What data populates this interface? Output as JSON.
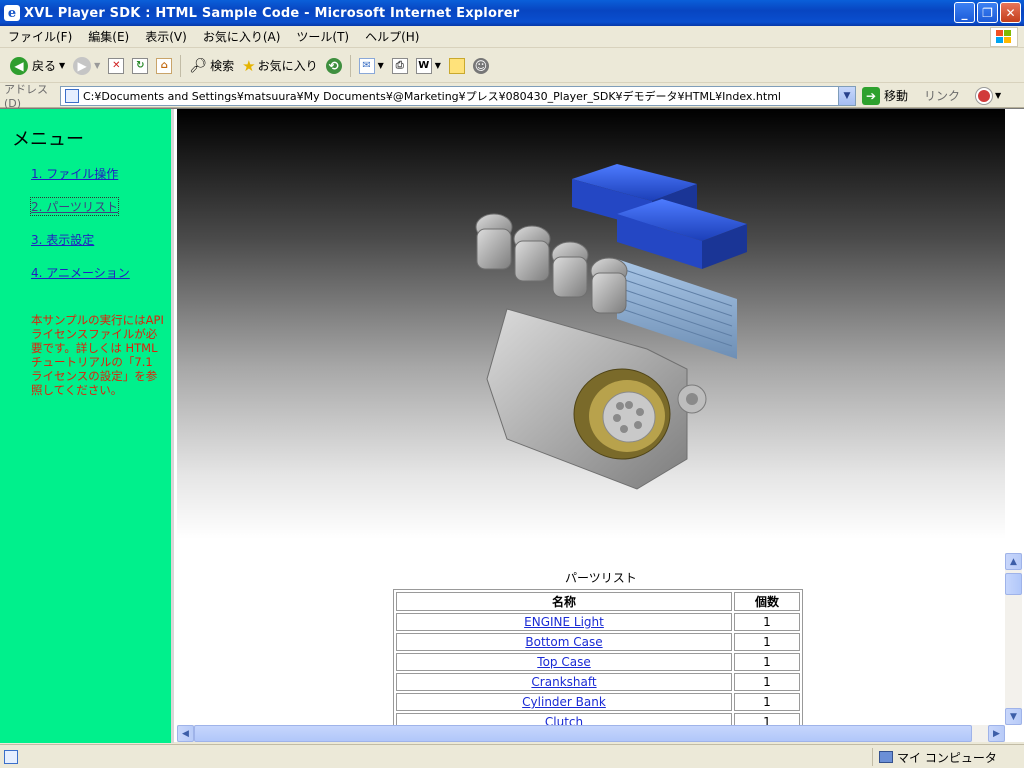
{
  "window": {
    "title": "XVL Player SDK : HTML Sample Code - Microsoft Internet Explorer",
    "minimize": "_",
    "maximize": "❐",
    "close": "✕"
  },
  "menubar": [
    "ファイル(F)",
    "編集(E)",
    "表示(V)",
    "お気に入り(A)",
    "ツール(T)",
    "ヘルプ(H)"
  ],
  "toolbar": {
    "back_label": "戻る",
    "search_label": "検索",
    "favorites_label": "お気に入り"
  },
  "addressbar": {
    "label": "アドレス(D)",
    "url": "C:¥Documents and Settings¥matsuura¥My Documents¥@Marketing¥プレス¥080430_Player_SDK¥デモデータ¥HTML¥Index.html",
    "go_label": "移動",
    "links_label": "リンク"
  },
  "menu": {
    "heading": "メニュー",
    "items": [
      "1. ファイル操作",
      "2. パーツリスト",
      "3. 表示設定",
      "4. アニメーション"
    ],
    "note": "本サンプルの実行にはAPIライセンスファイルが必要です。詳しくは HTML チュートリアルの「7.1 ライセンスの設定」を参照してください。"
  },
  "parts": {
    "caption": "パーツリスト",
    "header_name": "名称",
    "header_count": "個数",
    "rows": [
      {
        "name": "ENGINE Light",
        "count": "1"
      },
      {
        "name": "Bottom Case",
        "count": "1"
      },
      {
        "name": "Top Case",
        "count": "1"
      },
      {
        "name": "Crankshaft",
        "count": "1"
      },
      {
        "name": "Cylinder Bank",
        "count": "1"
      },
      {
        "name": "Clutch",
        "count": "1"
      }
    ]
  },
  "statusbar": {
    "zone_label": "マイ コンピュータ"
  }
}
